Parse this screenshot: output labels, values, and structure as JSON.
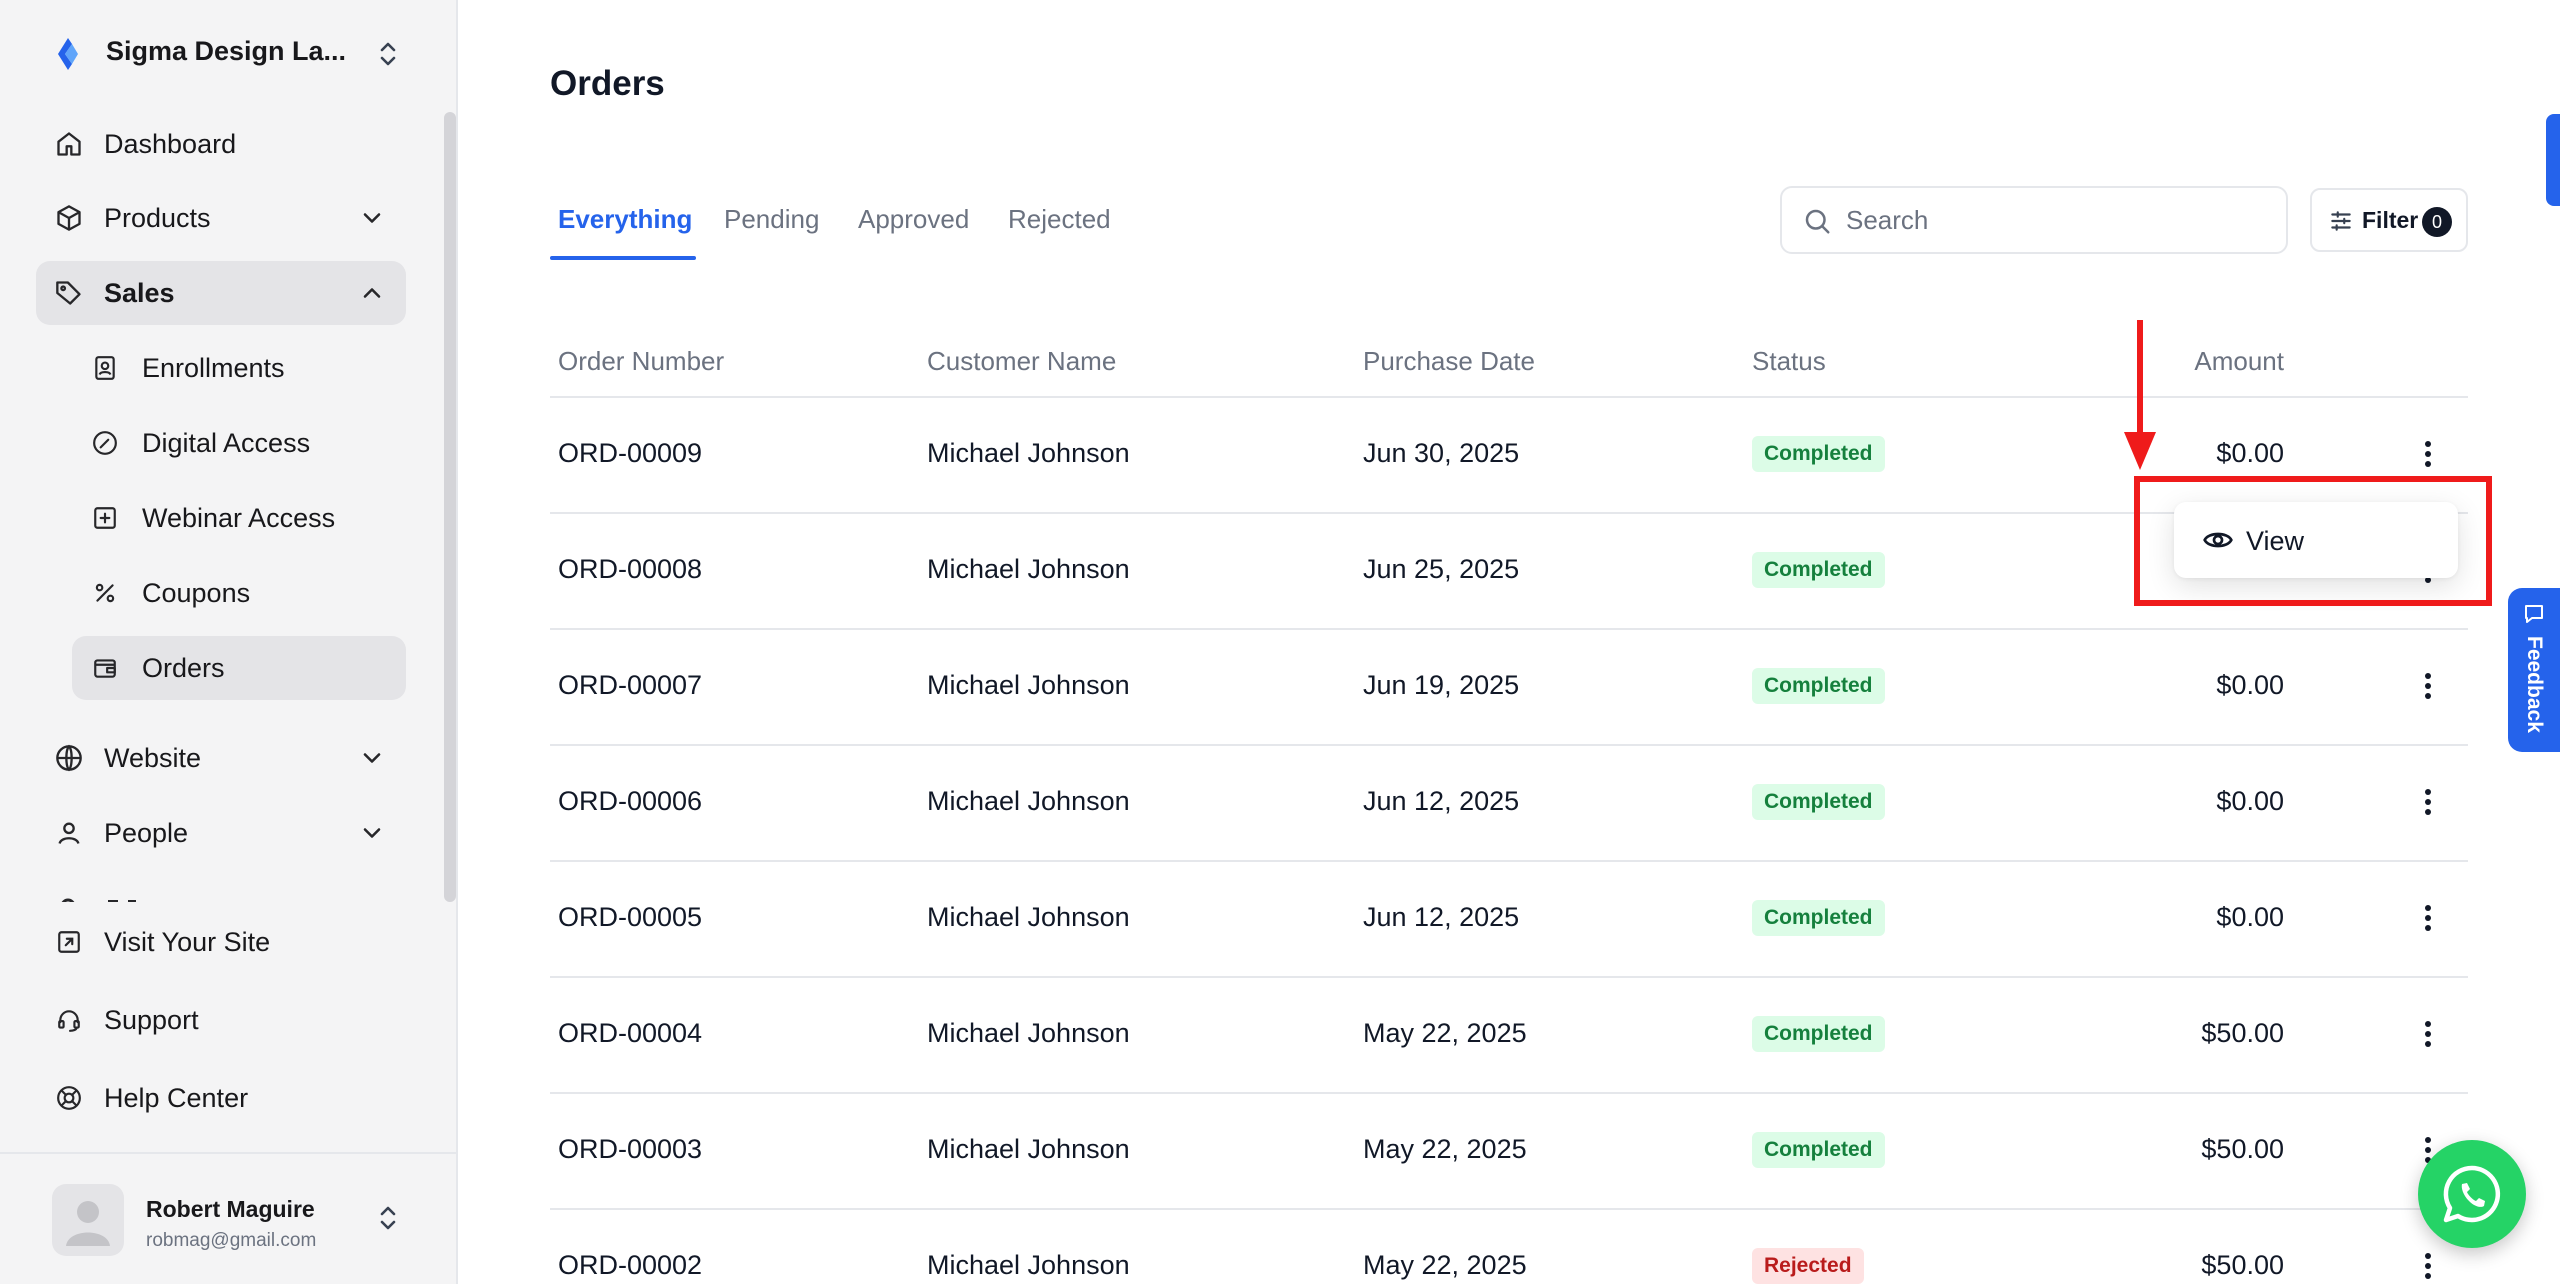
{
  "workspace": {
    "name": "Sigma Design La..."
  },
  "sidebar": {
    "nav": [
      {
        "label": "Dashboard",
        "icon": "home-icon"
      },
      {
        "label": "Products",
        "icon": "box-icon",
        "expanded": false
      },
      {
        "label": "Sales",
        "icon": "tag-icon",
        "expanded": true,
        "active": true,
        "children": [
          {
            "label": "Enrollments",
            "icon": "contact-book-icon"
          },
          {
            "label": "Digital Access",
            "icon": "gauge-icon"
          },
          {
            "label": "Webinar Access",
            "icon": "plus-square-icon"
          },
          {
            "label": "Coupons",
            "icon": "percent-icon"
          },
          {
            "label": "Orders",
            "icon": "wallet-icon",
            "active": true
          }
        ]
      },
      {
        "label": "Website",
        "icon": "globe-icon",
        "expanded": false
      },
      {
        "label": "People",
        "icon": "user-icon",
        "expanded": false
      }
    ],
    "footer_links": [
      {
        "label": "Visit Your Site",
        "icon": "external-link-icon"
      },
      {
        "label": "Support",
        "icon": "headset-icon"
      },
      {
        "label": "Help Center",
        "icon": "lifebuoy-icon"
      }
    ],
    "user": {
      "name": "Robert Maguire",
      "email": "robmag@gmail.com"
    }
  },
  "page": {
    "title": "Orders"
  },
  "tabs": [
    {
      "label": "Everything",
      "active": true
    },
    {
      "label": "Pending",
      "active": false
    },
    {
      "label": "Approved",
      "active": false
    },
    {
      "label": "Rejected",
      "active": false
    }
  ],
  "search": {
    "placeholder": "Search",
    "value": ""
  },
  "filter": {
    "label": "Filter",
    "count": "0"
  },
  "table": {
    "columns": [
      "Order Number",
      "Customer Name",
      "Purchase Date",
      "Status",
      "Amount"
    ],
    "rows": [
      {
        "order": "ORD-00009",
        "customer": "Michael Johnson",
        "date": "Jun 30, 2025",
        "status": "Completed",
        "amount": "$0.00"
      },
      {
        "order": "ORD-00008",
        "customer": "Michael Johnson",
        "date": "Jun 25, 2025",
        "status": "Completed",
        "amount": ""
      },
      {
        "order": "ORD-00007",
        "customer": "Michael Johnson",
        "date": "Jun 19, 2025",
        "status": "Completed",
        "amount": "$0.00"
      },
      {
        "order": "ORD-00006",
        "customer": "Michael Johnson",
        "date": "Jun 12, 2025",
        "status": "Completed",
        "amount": "$0.00"
      },
      {
        "order": "ORD-00005",
        "customer": "Michael Johnson",
        "date": "Jun 12, 2025",
        "status": "Completed",
        "amount": "$0.00"
      },
      {
        "order": "ORD-00004",
        "customer": "Michael Johnson",
        "date": "May 22, 2025",
        "status": "Completed",
        "amount": "$50.00"
      },
      {
        "order": "ORD-00003",
        "customer": "Michael Johnson",
        "date": "May 22, 2025",
        "status": "Completed",
        "amount": "$50.00"
      },
      {
        "order": "ORD-00002",
        "customer": "Michael Johnson",
        "date": "May 22, 2025",
        "status": "Rejected",
        "amount": "$50.00"
      }
    ]
  },
  "row_menu": {
    "items": [
      {
        "label": "View",
        "icon": "eye-icon"
      }
    ]
  },
  "feedback": {
    "label": "Feedback"
  },
  "colors": {
    "accent": "#2563eb",
    "completed_bg": "#dcfce7",
    "completed_text": "#15803d",
    "rejected_bg": "#fee2e2",
    "rejected_text": "#b91c1c",
    "annotation": "#ef1b1b",
    "whatsapp": "#25d366"
  }
}
